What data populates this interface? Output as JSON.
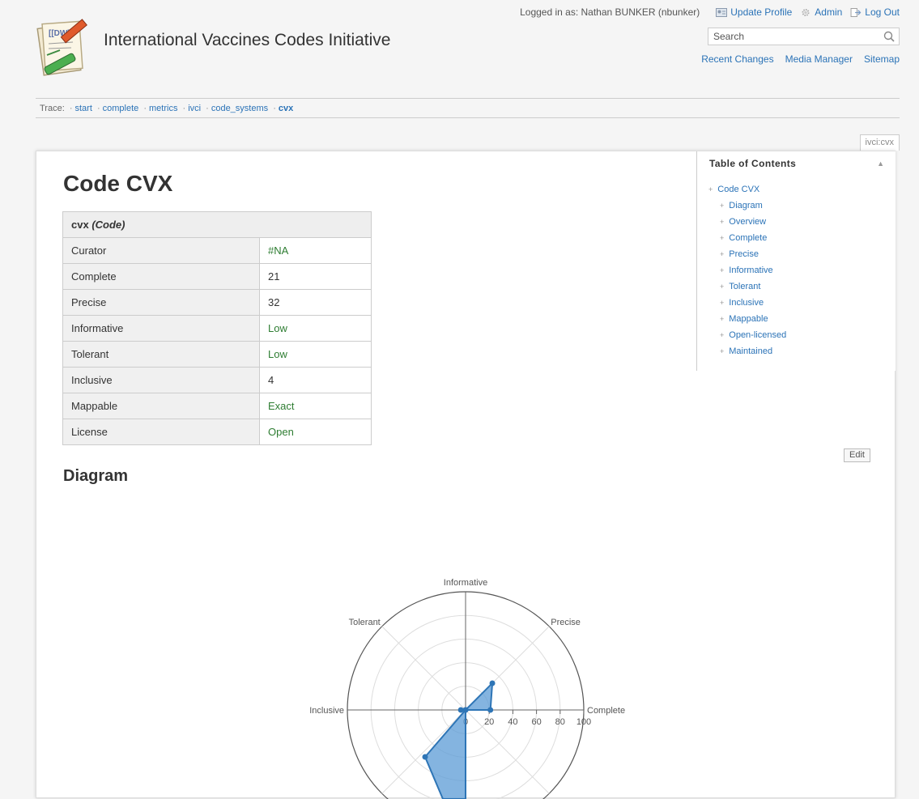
{
  "header": {
    "site_title": "International Vaccines Codes Initiative",
    "logged_in": "Logged in as: Nathan BUNKER (nbunker)",
    "update_profile": "Update Profile",
    "admin": "Admin",
    "logout": "Log Out",
    "search_placeholder": "Search",
    "links": [
      "Recent Changes",
      "Media Manager",
      "Sitemap"
    ]
  },
  "trace": {
    "label": "Trace:",
    "items": [
      "start",
      "complete",
      "metrics",
      "ivci",
      "code_systems"
    ],
    "current": "cvx"
  },
  "page_id": "ivci:cvx",
  "page": {
    "title": "Code CVX",
    "edit_label": "Edit",
    "diagram_heading": "Diagram"
  },
  "info_table": {
    "header_name": "cvx",
    "header_type": "(Code)",
    "rows": [
      {
        "label": "Curator",
        "value": "#NA"
      },
      {
        "label": "Complete",
        "value": "21"
      },
      {
        "label": "Precise",
        "value": "32"
      },
      {
        "label": "Informative",
        "value": "Low"
      },
      {
        "label": "Tolerant",
        "value": "Low"
      },
      {
        "label": "Inclusive",
        "value": "4"
      },
      {
        "label": "Mappable",
        "value": "Exact"
      },
      {
        "label": "License",
        "value": "Open"
      }
    ]
  },
  "toc": {
    "title": "Table of Contents",
    "top": "Code CVX",
    "items": [
      "Diagram",
      "Overview",
      "Complete",
      "Precise",
      "Informative",
      "Tolerant",
      "Inclusive",
      "Mappable",
      "Open-licensed",
      "Maintained"
    ]
  },
  "chart_data": {
    "type": "radar",
    "axes": [
      "Informative",
      "Precise",
      "Complete",
      "Tolerant",
      "Inclusive"
    ],
    "ticks": [
      "0",
      "20",
      "40",
      "60",
      "80",
      "100"
    ],
    "rlim": [
      0,
      100
    ],
    "fill_color": "#5b9bd5",
    "line_color": "#2e75b6",
    "series": [
      {
        "values": {
          "Complete": 21,
          "Precise": 32,
          "Informative": 0,
          "Tolerant": 0,
          "Inclusive": 4
        }
      }
    ]
  },
  "colors": {
    "link": "#2b73b7",
    "value_green": "#2e7d32"
  }
}
